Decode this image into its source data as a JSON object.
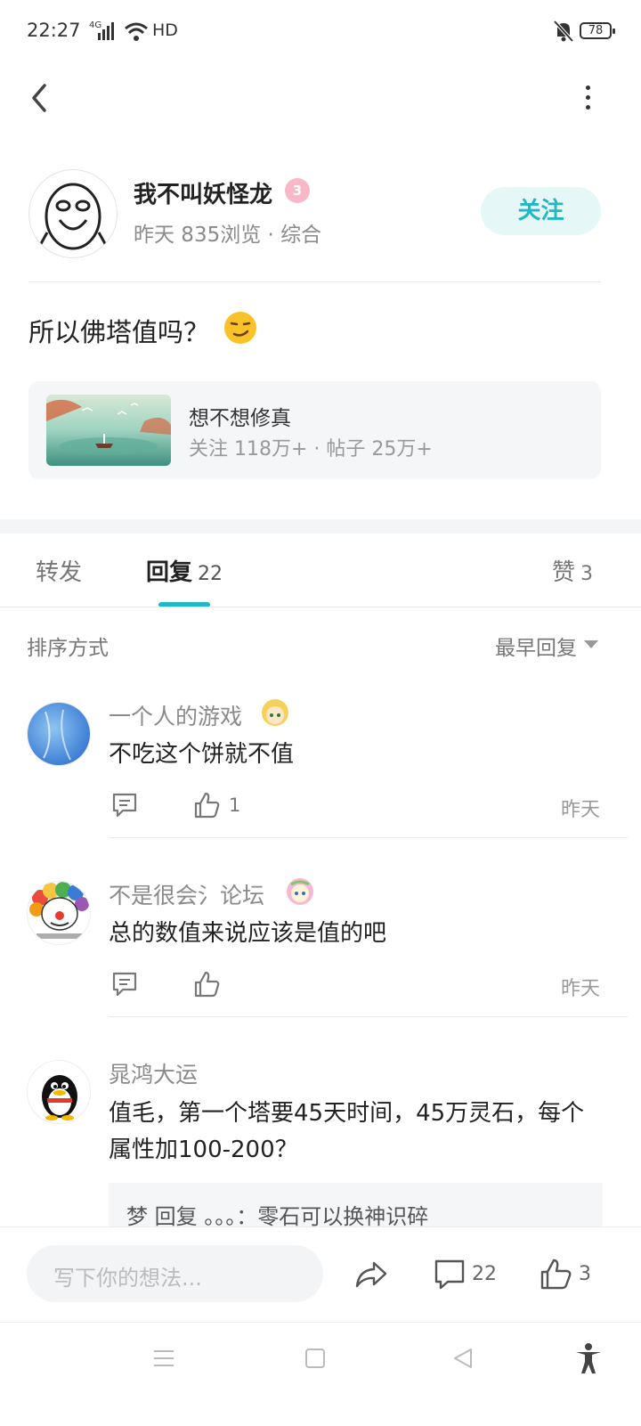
{
  "status_bar": {
    "time": "22:27",
    "network": "4G",
    "hd": "HD",
    "battery": "78"
  },
  "author": {
    "name": "我不叫妖怪龙",
    "level": "3",
    "meta": "昨天  835浏览 · 综合",
    "follow_label": "关注"
  },
  "post": {
    "title": "所以佛塔值吗？"
  },
  "forum": {
    "name": "想不想修真",
    "stats": "关注 118万+ · 帖子 25万+"
  },
  "tabs": {
    "repost": "转发",
    "reply": "回复",
    "reply_count": "22",
    "like": "赞",
    "like_count": "3"
  },
  "sort": {
    "label": "排序方式",
    "value": "最早回复"
  },
  "comments": [
    {
      "name": "一个人的游戏",
      "text": "不吃这个饼就不值",
      "like_count": "1",
      "time": "昨天"
    },
    {
      "name": "不是很会氵论坛",
      "text": "总的数值来说应该是值的吧",
      "like_count": "",
      "time": "昨天"
    },
    {
      "name": "晁鸿大运",
      "text": "值毛，第一个塔要45天时间，45万灵石，每个属性加100-200？",
      "quote": "梦 回复 。。。：零石可以换神识碎"
    }
  ],
  "bottom_bar": {
    "placeholder": "写下你的想法...",
    "comment_count": "22",
    "like_count": "3"
  },
  "colors": {
    "accent": "#1fb8c4",
    "follow_bg": "#e6f7f8"
  }
}
